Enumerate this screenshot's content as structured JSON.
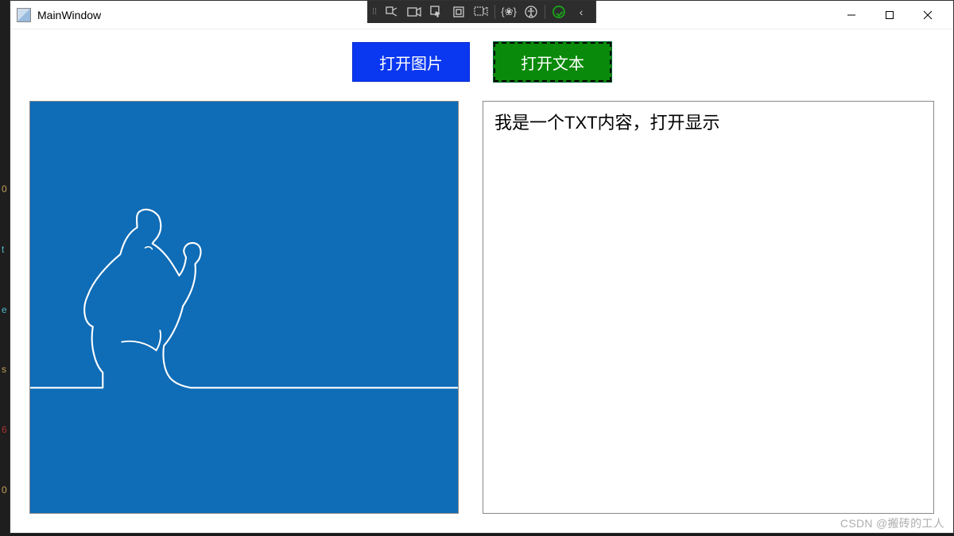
{
  "window": {
    "title": "MainWindow"
  },
  "debug_toolbar": {
    "items": [
      "live-visual-tree",
      "camera",
      "select-element",
      "layout-adorners",
      "hot-reload",
      "inspect",
      "accessibility",
      "pass-check",
      "more"
    ]
  },
  "buttons": {
    "open_image": "打开图片",
    "open_text": "打开文本"
  },
  "text_panel": {
    "content": "我是一个TXT内容，打开显示"
  },
  "window_controls": {
    "minimize": "—",
    "maximize": "☐",
    "close": "✕"
  },
  "watermark": "CSDN @搬砖的工人",
  "colors": {
    "blue_button": "#0a37f0",
    "green_button": "#0a8a0a",
    "image_bg": "#0f6cb6"
  }
}
